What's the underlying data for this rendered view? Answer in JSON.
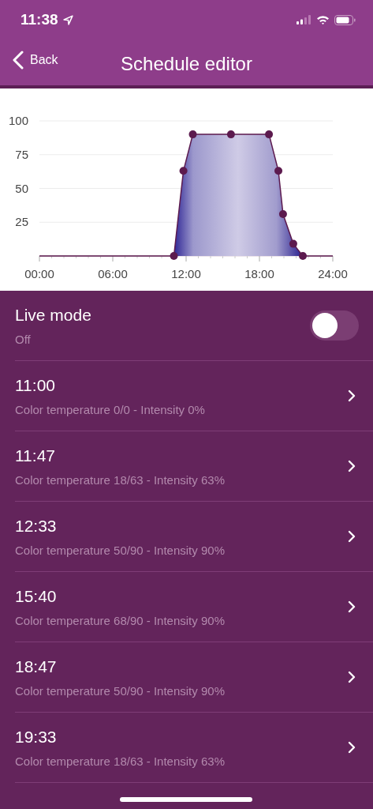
{
  "status_bar": {
    "time": "11:38"
  },
  "nav": {
    "back": "Back",
    "title": "Schedule editor"
  },
  "chart": {
    "chart_data": {
      "type": "area",
      "x": [
        0,
        11,
        11.78,
        12.55,
        15.67,
        18.78,
        19.55,
        19.93,
        20.77,
        21.55,
        24
      ],
      "series": [
        {
          "color": "#5c1a4e",
          "values": [
            0,
            0,
            63,
            90,
            90,
            90,
            63,
            31,
            9,
            0,
            0
          ]
        }
      ],
      "grid": true,
      "xlim": [
        0,
        24
      ],
      "ylim": [
        0,
        100
      ],
      "xticks": [
        {
          "value": 0,
          "label": "00:00"
        },
        {
          "value": 6,
          "label": "06:00"
        },
        {
          "value": 12,
          "label": "12:00"
        },
        {
          "value": 18,
          "label": "18:00"
        },
        {
          "value": 24,
          "label": "24:00"
        }
      ],
      "yticks": [
        {
          "value": 25,
          "label": "25"
        },
        {
          "value": 50,
          "label": "50"
        },
        {
          "value": 75,
          "label": "75"
        },
        {
          "value": 100,
          "label": "100"
        }
      ]
    }
  },
  "live_mode": {
    "label": "Live mode",
    "state": "Off",
    "on": false
  },
  "entries": [
    {
      "time": "11:00",
      "detail": "Color temperature 0/0 - Intensity 0%"
    },
    {
      "time": "11:47",
      "detail": "Color temperature 18/63 - Intensity 63%"
    },
    {
      "time": "12:33",
      "detail": "Color temperature 50/90 - Intensity 90%"
    },
    {
      "time": "15:40",
      "detail": "Color temperature 68/90 - Intensity 90%"
    },
    {
      "time": "18:47",
      "detail": "Color temperature 50/90 - Intensity 90%"
    },
    {
      "time": "19:33",
      "detail": "Color temperature 18/63 - Intensity 63%"
    }
  ]
}
